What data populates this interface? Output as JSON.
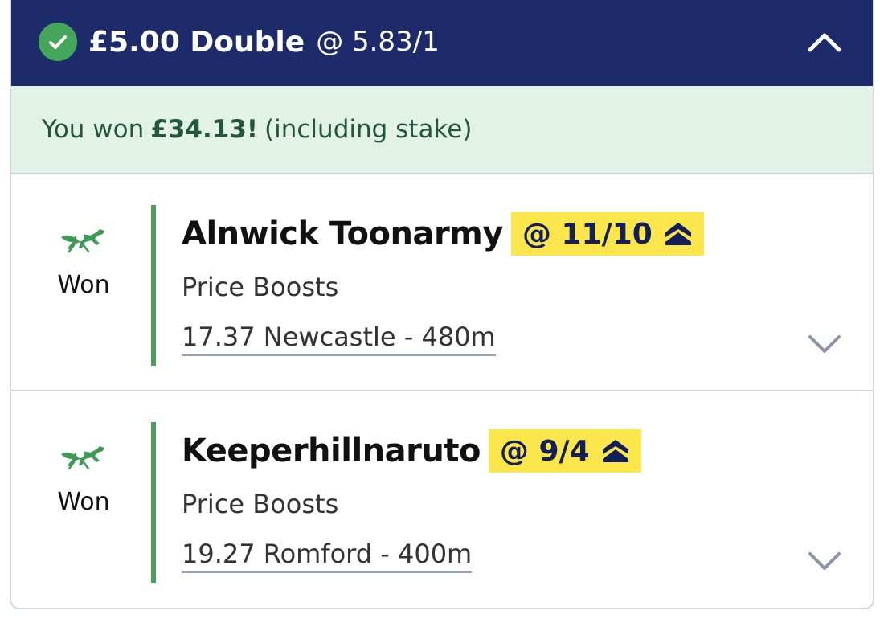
{
  "header": {
    "stake_type": "£5.00 Double",
    "odds": "@ 5.83/1",
    "status_icon": "check-circle-icon",
    "toggle_icon": "chevron-up-icon"
  },
  "banner": {
    "prefix": "You won",
    "amount": "£34.13!",
    "suffix": "(including stake)"
  },
  "legs": [
    {
      "result": "Won",
      "selection": "Alnwick Toonarmy",
      "price": "@ 11/10",
      "market": "Price Boosts",
      "event": "17.37 Newcastle - 480m",
      "sport_icon": "greyhound-icon",
      "boost_icon": "price-boost-icon"
    },
    {
      "result": "Won",
      "selection": "Keeperhillnaruto",
      "price": "@ 9/4",
      "market": "Price Boosts",
      "event": "19.27 Romford - 400m",
      "sport_icon": "greyhound-icon",
      "boost_icon": "price-boost-icon"
    }
  ],
  "colors": {
    "header_bg": "#1e2b6b",
    "win_banner_bg": "#e2f2e6",
    "win_text": "#24573a",
    "success_green": "#43a65a",
    "price_badge_bg": "#fbe64b",
    "price_text": "#121f5a"
  }
}
